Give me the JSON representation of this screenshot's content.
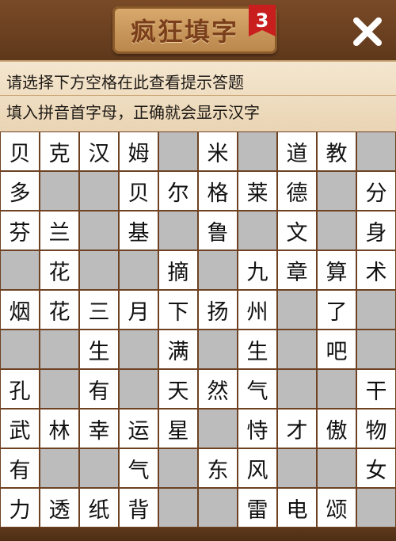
{
  "header": {
    "title": "疯狂填字",
    "level": "3",
    "close_icon": "close-icon"
  },
  "hint": {
    "line1": "请选择下方空格在此查看提示答题",
    "line2": "填入拼音首字母，正确就会显示汉字"
  },
  "colors": {
    "wood": "#6e4222",
    "cell_white": "#ffffff",
    "cell_blank": "#bcbcbc",
    "badge_red": "#c81e1e"
  },
  "grid": {
    "rows": [
      [
        "贝",
        "克",
        "汉",
        "姆",
        null,
        "米",
        null,
        "道",
        "教",
        null
      ],
      [
        "多",
        null,
        null,
        "贝",
        "尔",
        "格",
        "莱",
        "德",
        null,
        "分"
      ],
      [
        "芬",
        "兰",
        null,
        "基",
        null,
        "鲁",
        null,
        "文",
        null,
        "身"
      ],
      [
        null,
        "花",
        null,
        null,
        "摘",
        null,
        "九",
        "章",
        "算",
        "术"
      ],
      [
        "烟",
        "花",
        "三",
        "月",
        "下",
        "扬",
        "州",
        null,
        "了",
        null
      ],
      [
        null,
        null,
        "生",
        null,
        "满",
        null,
        "生",
        null,
        "吧",
        null
      ],
      [
        "孔",
        null,
        "有",
        null,
        "天",
        "然",
        "气",
        null,
        null,
        "干"
      ],
      [
        "武",
        "林",
        "幸",
        "运",
        "星",
        null,
        "恃",
        "才",
        "傲",
        "物"
      ],
      [
        "有",
        null,
        null,
        "气",
        null,
        "东",
        "风",
        null,
        null,
        "女"
      ],
      [
        "力",
        "透",
        "纸",
        "背",
        null,
        null,
        "雷",
        "电",
        "颂",
        null
      ]
    ]
  }
}
